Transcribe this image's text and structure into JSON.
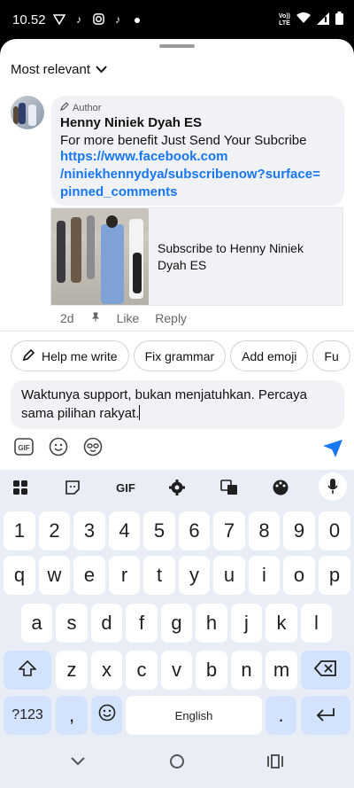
{
  "status_bar": {
    "time": "10.52",
    "volte": [
      "Vo))",
      "LTE"
    ]
  },
  "sheet": {
    "sort_label": "Most relevant",
    "comment": {
      "author_tag": "Author",
      "author_name": "Henny Niniek Dyah ES",
      "text": "For more benefit Just Send Your Subcribe",
      "link_line1": "https://www.facebook.com",
      "link_line2": "/niniekhennydya/subscribenow?surface=",
      "link_line3": "pinned_comments",
      "card_title": "Subscribe to Henny Niniek Dyah ES",
      "time": "2d",
      "like_label": "Like",
      "reply_label": "Reply"
    },
    "chips": [
      "Help me write",
      "Fix grammar",
      "Add emoji",
      "Fu"
    ],
    "input_text": "Waktunya support, bukan menjatuhkan. Percaya sama pilihan rakyat."
  },
  "keyboard": {
    "top_gif": "GIF",
    "row_numbers": [
      "1",
      "2",
      "3",
      "4",
      "5",
      "6",
      "7",
      "8",
      "9",
      "0"
    ],
    "row1": [
      "q",
      "w",
      "e",
      "r",
      "t",
      "y",
      "u",
      "i",
      "o",
      "p"
    ],
    "row2": [
      "a",
      "s",
      "d",
      "f",
      "g",
      "h",
      "j",
      "k",
      "l"
    ],
    "row3": [
      "z",
      "x",
      "c",
      "v",
      "b",
      "n",
      "m"
    ],
    "symbols_label": "?123",
    "comma": ",",
    "space_label": "English",
    "period": "."
  },
  "colors": {
    "link": "#1877f2",
    "send": "#1877f2",
    "keyboard_bg": "#e9eef6",
    "mod_key": "#d3e3fd"
  }
}
